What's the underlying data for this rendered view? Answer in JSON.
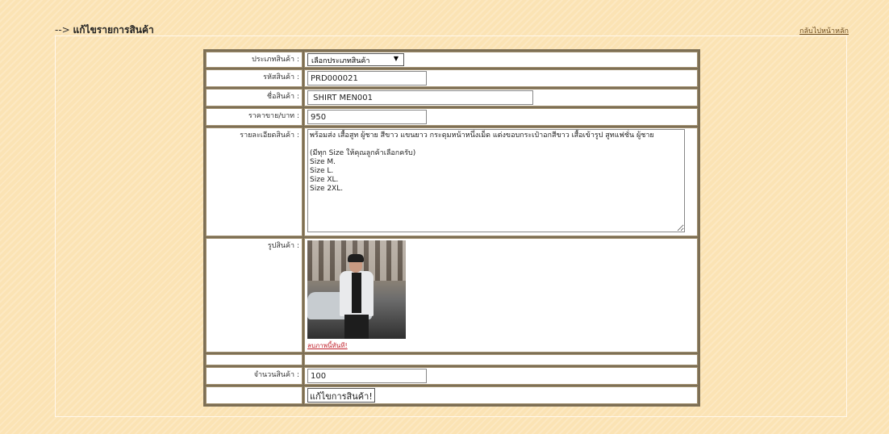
{
  "header": {
    "arrow": "-->",
    "title": "แก้ไขรายการสินค้า",
    "home_link": "กลับไปหน้าหลัก"
  },
  "form": {
    "category_label": "ประเภทสินค้า :",
    "category_selected": "เลือกประเภทสินค้า",
    "code_label": "รหัสสินค้า :",
    "code_value": "PRD000021",
    "name_label": "ชื่อสินค้า :",
    "name_value": " SHIRT MEN001",
    "price_label": "ราคาขาย/บาท :",
    "price_value": "950",
    "desc_label": "รายละเอียดสินค้า :",
    "desc_value": "พร้อมส่ง เสื้อสูท ผู้ชาย สีขาว แขนยาว กระดุมหน้าหนึ่งเม็ด แต่งขอบกระเป๋าอกสีขาว เสื้อเข้ารูป สูทแฟชั่น ผู้ชาย\n\n(มีทุก Size ให้คุณลูกค้าเลือกครับ)\nSize M.\nSize L.\nSize XL.\nSize 2XL.",
    "image_label": "รูปสินค้า :",
    "delete_image_link": "ลบภาพนี้ทันที!",
    "qty_label": "จำนวนสินค้า :",
    "qty_value": "100",
    "submit_label": "แก้ไขการสินค้า!"
  }
}
